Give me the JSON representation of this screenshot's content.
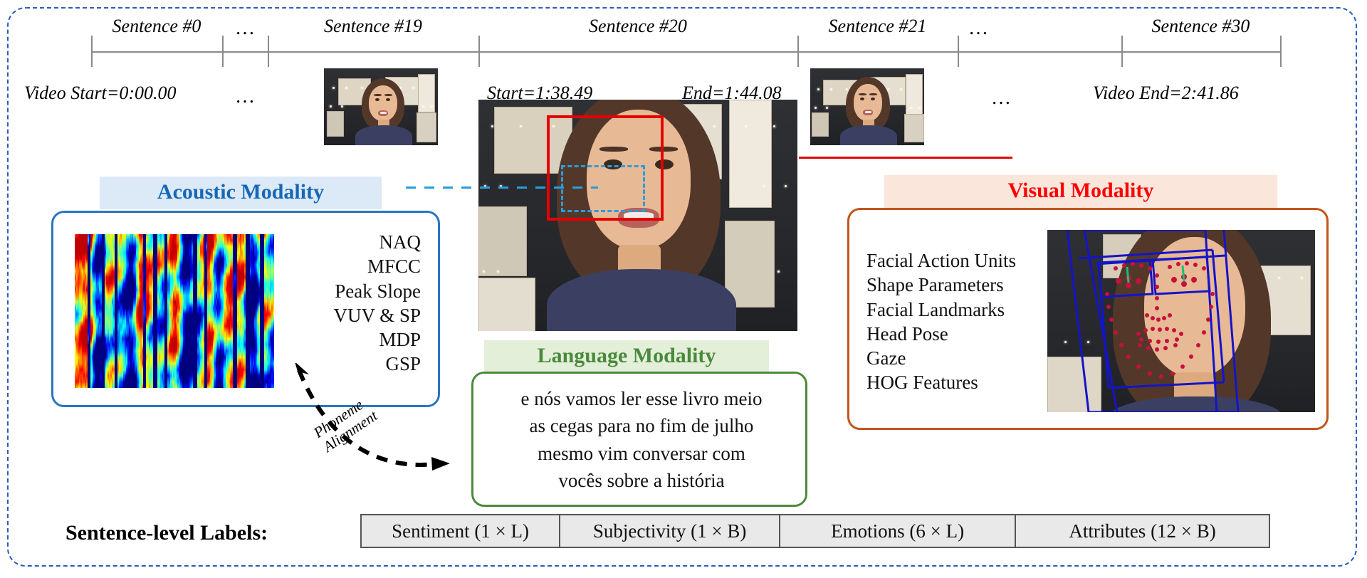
{
  "timeline": {
    "segments": [
      {
        "label": "Sentence #0"
      },
      {
        "label": "…"
      },
      {
        "label": "Sentence #19"
      },
      {
        "label": "Sentence #20"
      },
      {
        "label": "Sentence #21"
      },
      {
        "label": "…"
      },
      {
        "label": "Sentence #30"
      }
    ],
    "ellipsis_top_1": "…",
    "ellipsis_top_2": "…",
    "ellipsis_bottom_1": "…",
    "ellipsis_bottom_2": "…",
    "video_start": "Video Start=0:00.00",
    "video_end": "Video End=2:41.86",
    "segment_start": "Start=1:38.49",
    "segment_end": "End=1:44.08"
  },
  "acoustic": {
    "title": "Acoustic Modality",
    "title_color": "#1668b3",
    "title_bg": "#dce9f7",
    "border_color": "#2a74c0",
    "features": [
      "NAQ",
      "MFCC",
      "Peak Slope",
      "VUV & SP",
      "MDP",
      "GSP"
    ]
  },
  "visual": {
    "title": "Visual Modality",
    "title_color": "#ff0000",
    "title_bg": "#fbe6dc",
    "border_color": "#c2551c",
    "features": [
      "Facial Action Units",
      "Shape Parameters",
      "Facial Landmarks",
      "Head Pose",
      "Gaze",
      "HOG Features"
    ]
  },
  "language": {
    "title": "Language Modality",
    "title_color": "#4a8a3c",
    "title_bg": "#e4efd9",
    "border_color": "#4a8a3c",
    "lines": [
      "e nós vamos ler esse livro meio",
      "as cegas para no fim de julho",
      "mesmo vim conversar com",
      "vocês sobre a história"
    ]
  },
  "phoneme_alignment": {
    "line1": "Phoneme",
    "line2": "Alignment"
  },
  "bottom": {
    "title": "Sentence-level Labels:",
    "labels": [
      "Sentiment (1 × L)",
      "Subjectivity (1 × B)",
      "Emotions (6 × L)",
      "Attributes (12 × B)"
    ]
  }
}
